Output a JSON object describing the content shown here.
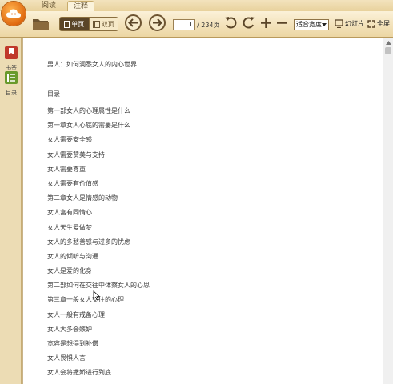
{
  "tabs": [
    {
      "label": "阅读"
    },
    {
      "label": "注释"
    }
  ],
  "toolbar": {
    "single_page_label": "单页",
    "double_page_label": "双页",
    "current_page": "1",
    "total_pages": "/ 234页",
    "zoom_value": "适合宽度",
    "slideshow_label": "幻灯片",
    "fullscreen_label": "全屏"
  },
  "sidebar": {
    "items": [
      {
        "label": "书签",
        "icon": "bookmark-icon"
      },
      {
        "label": "目录",
        "icon": "toc-icon"
      }
    ]
  },
  "document": {
    "title": "男人：如何洞悉女人的内心世界",
    "toc_heading": "目录",
    "toc_items": [
      "第一部女人的心理属性是什么",
      "第一章女人心底的需要是什么",
      "女人需要安全感",
      "女人需要赞美与支持",
      "女人需要尊重",
      "女人需要有价值感",
      "第二章女人是情感的动物",
      "女人富有同情心",
      "女人天生爱做梦",
      "女人的多愁善感与过多的忧虑",
      "女人的倾听与沟通",
      "女人是爱的化身",
      "第二部如何在交往中体察女人的心思",
      "第三章一般女人交往的心理",
      "女人一般有戒备心理",
      "女人大多会嫉妒",
      "宽容是想得到补偿",
      "女人畏惧人言",
      "女人会将撒娇进行到底"
    ]
  },
  "colors": {
    "chrome": "#ecd6a3",
    "accent_orange": "#e0690f",
    "dark_brown": "#5a4528"
  }
}
